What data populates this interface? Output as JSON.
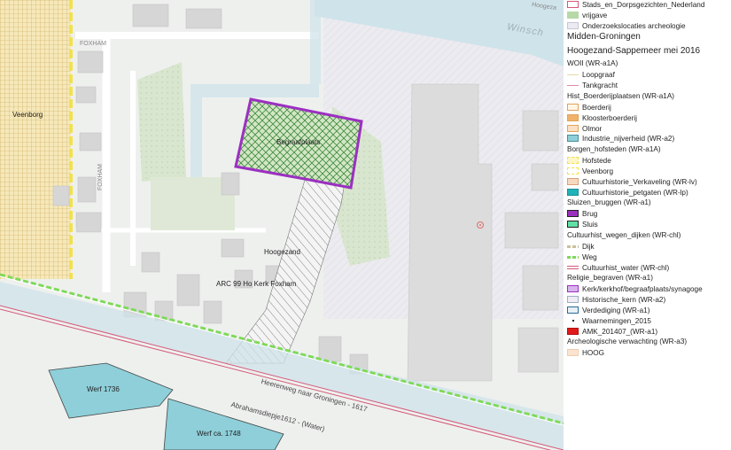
{
  "map": {
    "labels": {
      "veenborg": "Veenborg",
      "begraafplaats": "Begraafplaats",
      "hoogezand": "Hoogezand",
      "arc": "ARC 99 Ho Kerk Foxham",
      "foxham_top": "FOXHAM",
      "foxham_side": "FOXHAM",
      "winschoterdiep": "Winsch",
      "hoogezand_tr": "Hoogeza",
      "werf1736": "Werf 1736",
      "werf1748": "Werf ca. 1748",
      "heerenweg": "Heerenweg naar Groningen - 1617",
      "abrahamsdiepje": "Abrahamsdiepje1612 - (Water)"
    },
    "colors": {
      "background": "#eef0ee",
      "water": "#cfe3ea",
      "building": "#d9d9d9",
      "green": "#d3e4c8",
      "begraafplaats_outline": "#9b30c0",
      "veenborg_fill": "#f6e8b9",
      "veenborg_outline": "#f2e24a",
      "werf_fill": "#8ecfd9",
      "weg_line": "#7ed957",
      "water_line": "#d45a7a"
    }
  },
  "legend": {
    "items": [
      {
        "kind": "swatch",
        "label": "Stads_en_Dorpsgezichten_Nederland",
        "fill": "#ffffff",
        "border": "#d45a7a"
      },
      {
        "kind": "swatch",
        "label": "vrijgave",
        "fill": "#b7d9a8",
        "border": "#b7d9a8"
      },
      {
        "kind": "swatch",
        "label": "Onderzoekslocaties archeologie",
        "fill": "#eceaf2",
        "border": "#c8c6d2"
      },
      {
        "kind": "title",
        "label": "Midden-Groningen"
      },
      {
        "kind": "title",
        "label": "Hoogezand-Sappemeer mei 2016"
      },
      {
        "kind": "head",
        "label": "WOII (WR-a1A)"
      },
      {
        "kind": "line",
        "label": "Loopgraaf",
        "color": "#e7d9a6",
        "width": 1
      },
      {
        "kind": "line",
        "label": "Tankgracht",
        "color": "#e48aa3",
        "width": 1
      },
      {
        "kind": "head",
        "label": "Hist_Boerderijplaatsen (WR-a1A)"
      },
      {
        "kind": "swatch",
        "label": "Boerderij",
        "fill": "#fff6e5",
        "border": "#e2a35a"
      },
      {
        "kind": "swatch",
        "label": "Kloosterboerderij",
        "fill": "#f1b26b",
        "border": "#e2a35a"
      },
      {
        "kind": "swatch",
        "label": "Olmor",
        "fill": "#fbe0c4",
        "border": "#e2a35a"
      },
      {
        "kind": "swatch",
        "label": "Industrie_nijverheid (WR-a2)",
        "fill": "#8ecfd9",
        "border": "#4a8f99"
      },
      {
        "kind": "head",
        "label": "Borgen_hofsteden (WR-a1A)"
      },
      {
        "kind": "swatch",
        "label": "Hofstede",
        "fill": "#fff6c8",
        "border": "#f2e24a",
        "dashed": true
      },
      {
        "kind": "swatch",
        "label": "Veenborg",
        "fill": "#ffffff",
        "border": "#f2e24a",
        "dashed": true
      },
      {
        "kind": "swatch",
        "label": "Cultuurhistorie_Verkaveling (WR-lv)",
        "fill": "#f7d9bf",
        "border": "#d9a27a"
      },
      {
        "kind": "swatch",
        "label": "Cultuurhistorie_petgaten (WR-lp)",
        "fill": "#1fb3b8",
        "border": "#1a8f94"
      },
      {
        "kind": "head",
        "label": "Sluizen_bruggen (WR-a1)"
      },
      {
        "kind": "swatch",
        "label": "Brug",
        "fill": "#9b30c0",
        "border": "#222222"
      },
      {
        "kind": "swatch",
        "label": "Sluis",
        "fill": "#62e0a6",
        "border": "#222222"
      },
      {
        "kind": "head",
        "label": "Cultuurhist_wegen_dijken (WR-chl)"
      },
      {
        "kind": "line",
        "label": "Dijk",
        "color": "#c8c09a",
        "width": 3,
        "dash": "2,1"
      },
      {
        "kind": "line",
        "label": "Weg",
        "color": "#7ed957",
        "width": 3,
        "dash": "4,2"
      },
      {
        "kind": "line2",
        "label": "Cultuurhist_water (WR-chl)",
        "color": "#d45a7a"
      },
      {
        "kind": "head",
        "label": "Religie_begraven (WR-a1)"
      },
      {
        "kind": "swatch",
        "label": "Kerk/kerkhof/begraafplaats/synagoge",
        "fill": "#d8b4ec",
        "border": "#9b30c0"
      },
      {
        "kind": "swatch",
        "label": "Historische_kern (WR-a2)",
        "fill": "#f0ecf4",
        "border": "#9ab0c0"
      },
      {
        "kind": "swatch",
        "label": "Verdediging (WR-a1)",
        "fill": "#e8f0f6",
        "border": "#2a6a9a"
      },
      {
        "kind": "dot",
        "label": "Waarnemingen_2015"
      },
      {
        "kind": "swatch",
        "label": "AMK_201407_(WR-a1)",
        "fill": "#e01b1b",
        "border": "#b01010"
      },
      {
        "kind": "head",
        "label": "Archeologische verwachting (WR-a3)"
      },
      {
        "kind": "swatch",
        "label": "HOOG",
        "fill": "#fbe3cf",
        "border": "#f0cdb0"
      }
    ]
  }
}
